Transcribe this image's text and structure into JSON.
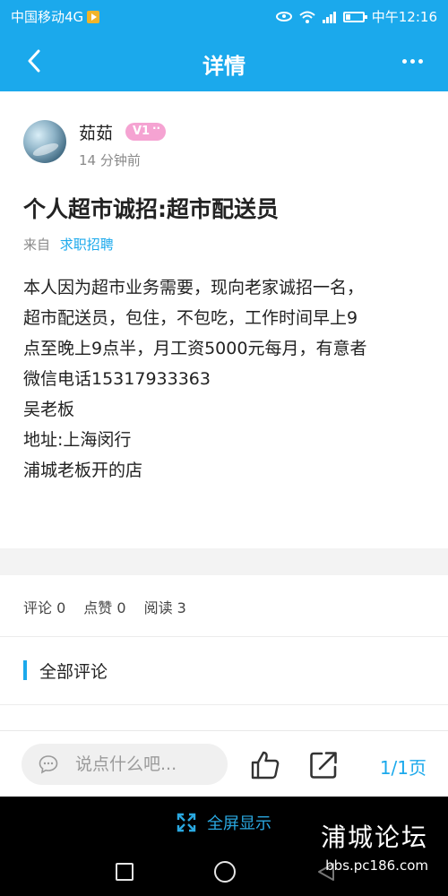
{
  "status_bar": {
    "carrier": "中国移动4G",
    "time": "中午12:16"
  },
  "header": {
    "title": "详情"
  },
  "post": {
    "author": "茹茹",
    "badge": "V1",
    "time": "14 分钟前",
    "title": "个人超市诚招:超市配送员",
    "source_prefix": "来自",
    "source_link": "求职招聘",
    "body_lines": [
      "本人因为超市业务需要，现向老家诚招一名，",
      "超市配送员，包住，不包吃，工作时间早上9",
      "点至晚上9点半，月工资5000元每月，有意者",
      "微信电话15317933363",
      "吴老板",
      "地址:上海闵行",
      "浦城老板开的店"
    ]
  },
  "stats": {
    "comments": "评论 0",
    "likes": "点赞 0",
    "reads": "阅读 3"
  },
  "comments_section": {
    "title": "全部评论"
  },
  "comment_bar": {
    "placeholder": "说点什么吧...",
    "page": "1/1页"
  },
  "system": {
    "fullscreen_label": "全屏显示"
  },
  "watermark": {
    "name": "浦城论坛",
    "url": "bbs.pc186.com"
  },
  "colors": {
    "accent": "#1ba9ec",
    "badge": "#f5a3d2"
  }
}
